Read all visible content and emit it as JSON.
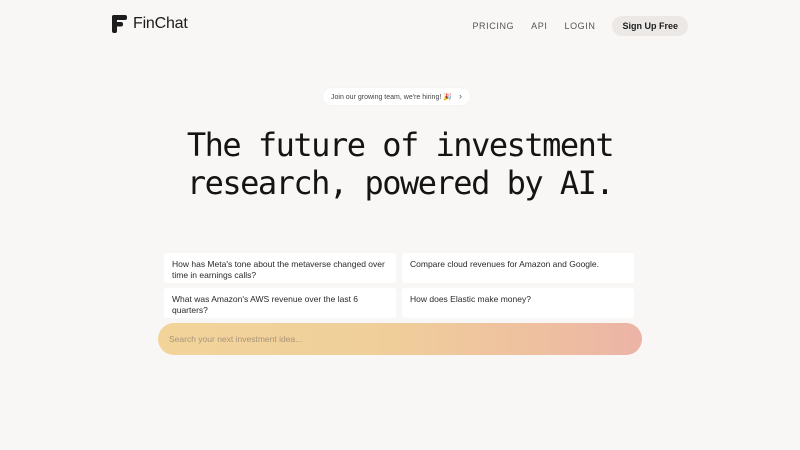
{
  "header": {
    "brand": "FinChat",
    "nav": {
      "pricing": "PRICING",
      "api": "API",
      "login": "LOGIN",
      "signup": "Sign Up Free"
    }
  },
  "hiring_banner": {
    "text": "Join our growing team, we're hiring! 🎉",
    "chevron": "›"
  },
  "hero": {
    "line1": "The future of investment",
    "line2": "research, powered by AI."
  },
  "suggestions": [
    "How has Meta's tone about the metaverse changed over time in earnings calls?",
    "Compare cloud revenues for Amazon and Google.",
    "What was Amazon's AWS revenue over the last 6 quarters?",
    "How does Elastic make money?"
  ],
  "search": {
    "placeholder": "Search your next investment idea...",
    "value": ""
  },
  "colors": {
    "background": "#f9f7f5",
    "text": "#1c1c1c",
    "signup_bg": "#ebe8e5",
    "search_gradient_start": "#f2d49a",
    "search_gradient_end": "#ecb3a6"
  }
}
